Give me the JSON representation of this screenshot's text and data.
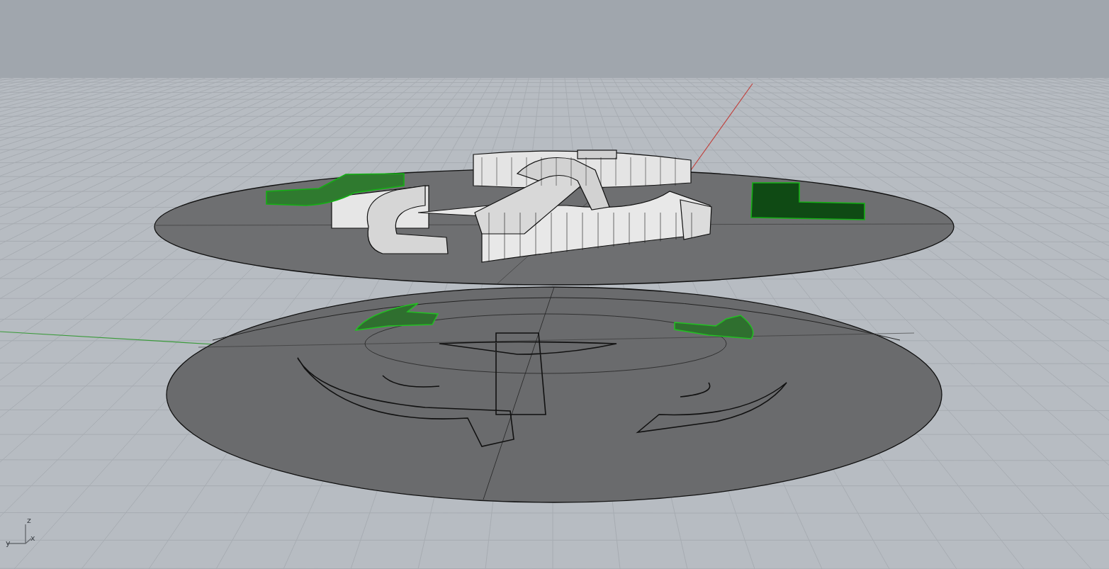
{
  "viewport": {
    "axis_labels": [
      "z",
      "y",
      "x"
    ]
  }
}
